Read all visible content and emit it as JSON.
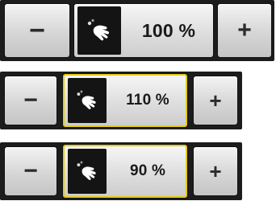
{
  "zoom_controls": [
    {
      "decrease_label": "−",
      "increase_label": "+",
      "value": "100 %",
      "selected": false
    },
    {
      "decrease_label": "−",
      "increase_label": "+",
      "value": "110 %",
      "selected": true
    },
    {
      "decrease_label": "−",
      "increase_label": "+",
      "value": "90 %",
      "selected": true
    }
  ],
  "colors": {
    "selection_outline": "#e2cc14",
    "strip_background": "#1c1c1c"
  },
  "icons": {
    "hand": "hand-gesture-icon"
  }
}
